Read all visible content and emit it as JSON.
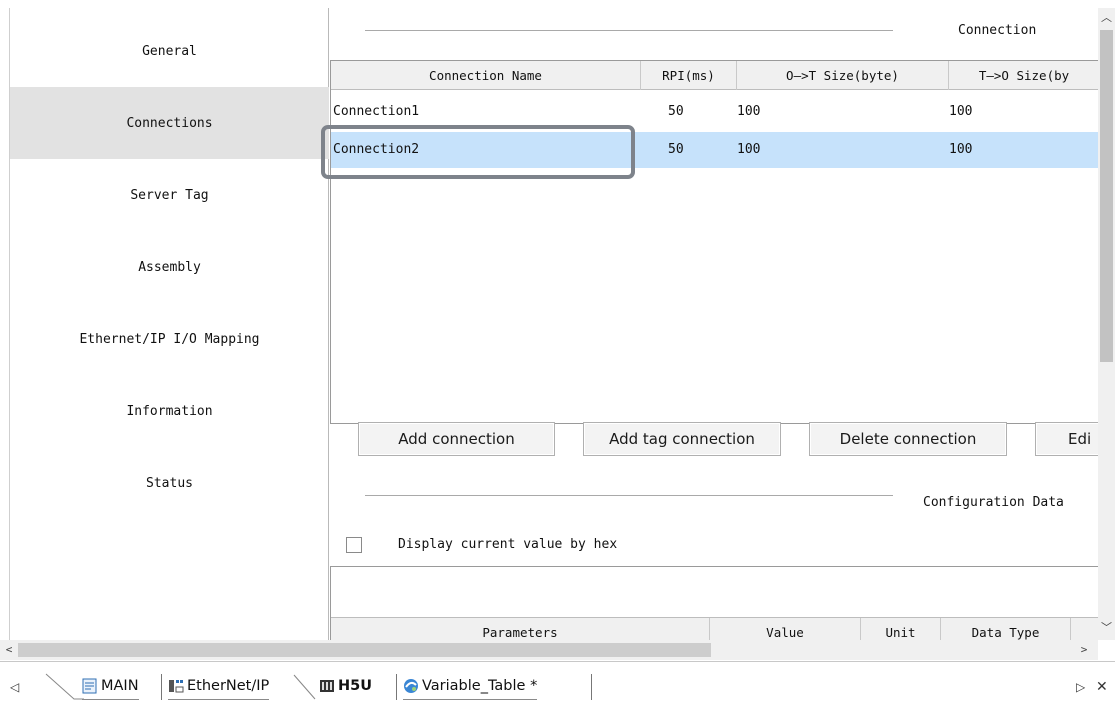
{
  "sidebar": {
    "items": [
      {
        "label": "General"
      },
      {
        "label": "Connections"
      },
      {
        "label": "Server Tag"
      },
      {
        "label": "Assembly"
      },
      {
        "label": "Ethernet/IP I/O Mapping"
      },
      {
        "label": "Information"
      },
      {
        "label": "Status"
      }
    ],
    "selected": "Connections"
  },
  "connection_section": {
    "title": "Connection",
    "columns": [
      "Connection Name",
      "RPI(ms)",
      "O—>T Size(byte)",
      "T—>O Size(by"
    ],
    "rows": [
      {
        "name": "Connection1",
        "rpi": "50",
        "ot_size": "100",
        "to_size": "100"
      },
      {
        "name": "Connection2",
        "rpi": "50",
        "ot_size": "100",
        "to_size": "100"
      }
    ],
    "selected_row": "Connection2"
  },
  "buttons": {
    "add_connection": "Add connection",
    "add_tag_connection": "Add tag connection",
    "delete_connection": "Delete connection",
    "edit": "Edi"
  },
  "config_section": {
    "title": "Configuration Data",
    "hex_checkbox_label": "Display current value by hex",
    "hex_checked": false,
    "columns": [
      "Parameters",
      "Value",
      "Unit",
      "Data Type"
    ]
  },
  "tabs": {
    "items": [
      {
        "label": "MAIN",
        "icon": "ladder-program-icon"
      },
      {
        "label": "EtherNet/IP",
        "icon": "network-device-icon"
      },
      {
        "label": "H5U",
        "icon": "plc-device-icon"
      },
      {
        "label": "Variable_Table *",
        "icon": "variable-table-icon"
      }
    ],
    "active": "H5U"
  },
  "colors": {
    "selected_row": "#c6e2fb",
    "sidebar_selected": "#e2e2e2",
    "highlight_box": "#7e838b"
  }
}
